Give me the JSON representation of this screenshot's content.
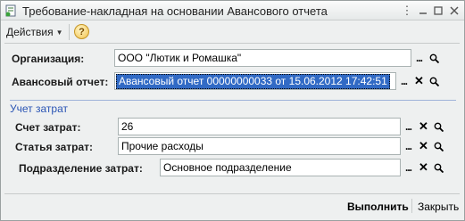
{
  "window": {
    "title": "Требование-накладная на основании Авансового отчета"
  },
  "toolbar": {
    "actions_label": "Действия",
    "help_label": "?"
  },
  "fields": {
    "organization": {
      "label": "Организация:",
      "value": "ООО \"Лютик и Ромашка\""
    },
    "advance_report": {
      "label": "Авансовый отчет:",
      "value": "Авансовый отчет 00000000033 от 15.06.2012 17:42:51"
    }
  },
  "cost_group": {
    "title": "Учет затрат",
    "account": {
      "label": "Счет затрат:",
      "value": "26"
    },
    "item": {
      "label": "Статья затрат:",
      "value": "Прочие расходы"
    },
    "department": {
      "label": "Подразделение затрат:",
      "value": "Основное подразделение"
    }
  },
  "buttons": {
    "execute": "Выполнить",
    "close": "Закрыть"
  },
  "colors": {
    "selection": "#316ac5",
    "group_title": "#2a54b4"
  }
}
